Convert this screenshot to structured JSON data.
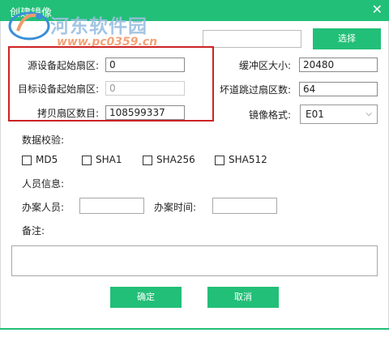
{
  "window": {
    "title": "创建镜像",
    "close_icon": "close-icon"
  },
  "watermark": {
    "title": "河东软件园",
    "url": "www.pc0359.cn"
  },
  "browse": {
    "label": "选择",
    "path_value": ""
  },
  "fields": {
    "source_start_label": "源设备起始扇区:",
    "source_start_value": "0",
    "target_start_label": "目标设备起始扇区:",
    "target_start_value": "0",
    "copy_count_label": "拷贝扇区数目:",
    "copy_count_value": "108599337",
    "buffer_label": "缓冲区大小:",
    "buffer_value": "20480",
    "skip_label": "坏道跳过扇区数:",
    "skip_value": "64",
    "format_label": "镜像格式:",
    "format_value": "E01"
  },
  "checksum": {
    "label": "数据校验:",
    "options": [
      "MD5",
      "SHA1",
      "SHA256",
      "SHA512"
    ]
  },
  "personnel": {
    "label": "人员信息:",
    "handler_label": "办案人员:",
    "time_label": "办案时间:",
    "handler_value": "",
    "time_value": ""
  },
  "notes": {
    "label": "备注:",
    "value": ""
  },
  "buttons": {
    "ok": "确定",
    "cancel": "取消"
  },
  "colors": {
    "accent": "#22bf78",
    "highlight": "#cc2323"
  }
}
